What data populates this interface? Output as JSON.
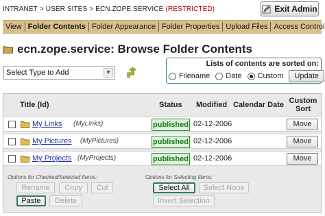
{
  "breadcrumb": {
    "items": [
      "INTRANET",
      "USER SITES",
      "ECN.ZOPE.SERVICE"
    ],
    "separator": ">",
    "restricted": "(RESTRICTED)"
  },
  "header": {
    "exit_label": "Exit Admin"
  },
  "tabs": [
    {
      "label": "View",
      "active": false
    },
    {
      "label": "Folder Contents",
      "active": true
    },
    {
      "label": "Folder Appearance",
      "active": false
    },
    {
      "label": "Folder Properties",
      "active": false
    },
    {
      "label": "Upload Files",
      "active": false
    },
    {
      "label": "Access Control",
      "active": false
    }
  ],
  "page": {
    "site": "ecn.zope.service:",
    "title": "Browse Folder Contents"
  },
  "add": {
    "select_value": "Select Type to Add"
  },
  "sort": {
    "title": "Lists of contents are sorted on:",
    "options": [
      "Filename",
      "Date",
      "Custom"
    ],
    "selected": "Custom",
    "update_label": "Update"
  },
  "table": {
    "headers": {
      "title": "Title (Id)",
      "status": "Status",
      "modified": "Modified",
      "calendar": "Calendar Date",
      "custom_sort_line1": "Custom",
      "custom_sort_line2": "Sort"
    },
    "rows": [
      {
        "title": "My Links",
        "id": "(MyLinks)",
        "status": "published",
        "modified": "02-12-2006",
        "calendar": "",
        "action": "Move"
      },
      {
        "title": "My Pictures",
        "id": "(MyPictures)",
        "status": "published",
        "modified": "02-12-2006",
        "calendar": "",
        "action": "Move"
      },
      {
        "title": "My Projects",
        "id": "(MyProjects)",
        "status": "published",
        "modified": "02-12-2006",
        "calendar": "",
        "action": "Move"
      }
    ]
  },
  "checked_options": {
    "label": "Options for Checked/Selected Items:",
    "rename": "Rename",
    "copy": "Copy",
    "cut": "Cut",
    "paste": "Paste",
    "delete": "Delete"
  },
  "selecting_options": {
    "label": "Options for Selecting Items:",
    "select_all": "Select All",
    "select_none": "Select None",
    "invert": "Invert Selection"
  },
  "colors": {
    "tabbar": "#d8c08c",
    "restricted": "#b00000",
    "link": "#1a2fa8",
    "published_text": "#1e7a1e",
    "published_bg": "#dcf4dc",
    "focus_border": "#2e7d5a"
  }
}
